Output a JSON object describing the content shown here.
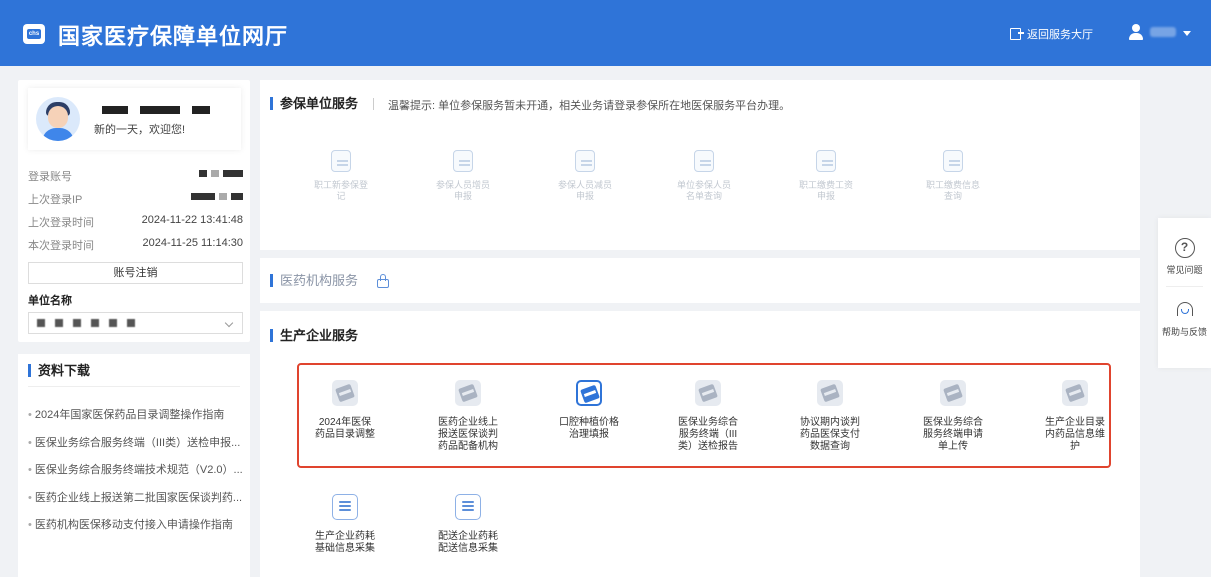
{
  "header": {
    "logo_text": "chs",
    "title": "国家医疗保障单位网厅",
    "return_label": "返回服务大厅"
  },
  "profile": {
    "welcome": "新的一天，欢迎您!",
    "login_account_label": "登录账号",
    "last_ip_label": "上次登录IP",
    "last_login_label": "上次登录时间",
    "last_login_value": "2024-11-22 13:41:48",
    "this_login_label": "本次登录时间",
    "this_login_value": "2024-11-25 11:14:30",
    "cancel_account": "账号注销",
    "unit_name_label": "单位名称"
  },
  "downloads": {
    "title": "资料下载",
    "items": [
      "2024年国家医保药品目录调整操作指南",
      "医保业务综合服务终端（III类）送检申报...",
      "医保业务综合服务终端技术规范（V2.0）...",
      "医药企业线上报送第二批国家医保谈判药...",
      "医药机构医保移动支付接入申请操作指南"
    ]
  },
  "insured_unit": {
    "title": "参保单位服务",
    "tip": "温馨提示: 单位参保服务暂未开通，相关业务请登录参保所在地医保服务平台办理。",
    "items": [
      {
        "line1": "职工新参保登",
        "line2": "记",
        "icon": "register-icon"
      },
      {
        "line1": "参保人员增员",
        "line2": "申报",
        "icon": "add-person-icon"
      },
      {
        "line1": "参保人员减员",
        "line2": "申报",
        "icon": "remove-person-icon"
      },
      {
        "line1": "单位参保人员",
        "line2": "名单查询",
        "icon": "person-list-icon"
      },
      {
        "line1": "职工缴费工资",
        "line2": "申报",
        "icon": "wage-report-icon"
      },
      {
        "line1": "职工缴费信息",
        "line2": "查询",
        "icon": "payment-query-icon"
      }
    ]
  },
  "medical_institution": {
    "title": "医药机构服务"
  },
  "production": {
    "title": "生产企业服务",
    "items": [
      {
        "line1": "2024年医保",
        "line2": "药品目录调整",
        "line3": ""
      },
      {
        "line1": "医药企业线上",
        "line2": "报送医保谈判",
        "line3": "药品配备机构"
      },
      {
        "line1": "口腔种植价格",
        "line2": "治理填报",
        "line3": ""
      },
      {
        "line1": "医保业务综合",
        "line2": "服务终端（III",
        "line3": "类）送检报告"
      },
      {
        "line1": "协议期内谈判",
        "line2": "药品医保支付",
        "line3": "数据查询"
      },
      {
        "line1": "医保业务综合",
        "line2": "服务终端申请",
        "line3": "单上传"
      },
      {
        "line1": "生产企业目录",
        "line2": "内药品信息维",
        "line3": "护"
      },
      {
        "line1": "生产企业药耗",
        "line2": "基础信息采集",
        "line3": ""
      },
      {
        "line1": "配送企业药耗",
        "line2": "配送信息采集",
        "line3": ""
      }
    ]
  },
  "float": {
    "faq": "常见问题",
    "faq_glyph": "?",
    "help": "帮助与反馈"
  }
}
